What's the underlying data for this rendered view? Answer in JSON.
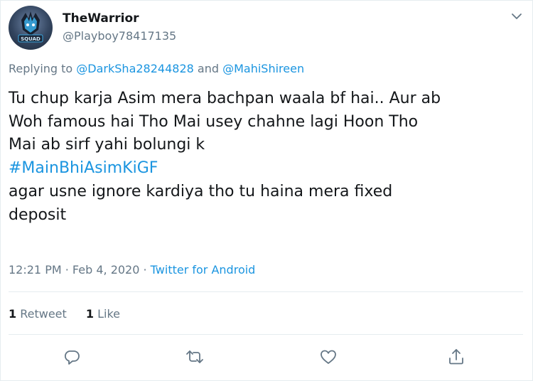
{
  "user": {
    "display_name": "TheWarrior",
    "handle": "@Playboy78417135",
    "avatar_text": "SQUAD"
  },
  "reply": {
    "prefix": "Replying to ",
    "mention1": "@DarkSha28244828",
    "joiner": " and ",
    "mention2": "@MahiShireen"
  },
  "tweet": {
    "line1": "Tu chup karja Asim mera bachpan waala bf hai.. Aur ab",
    "line2": "Woh famous hai Tho Mai usey chahne lagi Hoon Tho",
    "line3": "Mai ab sirf yahi bolungi k",
    "hashtag": "#MainBhiAsimKiGF",
    "line5": "agar usne ignore kardiya tho tu haina mera fixed",
    "line6": "deposit"
  },
  "meta": {
    "time": "12:21 PM",
    "sep1": " · ",
    "date": "Feb 4, 2020",
    "sep2": " · ",
    "source": "Twitter for Android"
  },
  "stats": {
    "retweets_count": "1",
    "retweets_label": " Retweet",
    "likes_count": "1",
    "likes_label": " Like"
  },
  "icons": {
    "caret": "chevron-down-icon",
    "reply": "reply-icon",
    "retweet": "retweet-icon",
    "like": "heart-icon",
    "share": "share-icon"
  },
  "colors": {
    "link": "#1b95e0",
    "muted": "#657786",
    "text": "#14171a",
    "divider": "#e6ecf0"
  }
}
